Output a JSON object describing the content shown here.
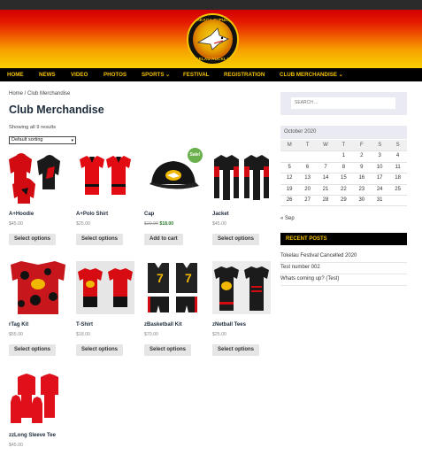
{
  "header": {
    "logo_top": "HAFAKAGA TUPULAGA",
    "logo_bottom": "TOKELAU AUCKLAND"
  },
  "nav": {
    "items": [
      {
        "label": "HOME"
      },
      {
        "label": "NEWS"
      },
      {
        "label": "VIDEO"
      },
      {
        "label": "PHOTOS"
      },
      {
        "label": "SPORTS ⌄"
      },
      {
        "label": "FESTIVAL"
      },
      {
        "label": "REGISTRATION"
      },
      {
        "label": "CLUB MERCHANDISE ⌄"
      }
    ]
  },
  "breadcrumb": "Home / Club Merchandise",
  "page_title": "Club Merchandise",
  "results_text": "Showing all 9 results",
  "sort": {
    "selected": "Default sorting"
  },
  "products": [
    {
      "name": "A+Hoodie",
      "price": "$45.00",
      "button": "Select options"
    },
    {
      "name": "A+Polo Shirt",
      "price": "$25.00",
      "button": "Select options"
    },
    {
      "name": "Cap",
      "old_price": "$20.00",
      "price": "$18.00",
      "button": "Add to cart",
      "badge": "Sale!"
    },
    {
      "name": "Jacket",
      "price": "$45.00",
      "button": "Select options"
    },
    {
      "name": "rTag Kit",
      "price": "$55.00",
      "button": "Select options"
    },
    {
      "name": "T-Shirt",
      "price": "$18.00",
      "button": "Select options"
    },
    {
      "name": "zBasketball Kit",
      "price": "$70.00",
      "button": "Select options"
    },
    {
      "name": "zNetball Tees",
      "price": "$25.00",
      "button": "Select options"
    },
    {
      "name": "zzLong Sleeve Tee",
      "price": "$45.00",
      "button": "Select options"
    }
  ],
  "search": {
    "placeholder": "SEARCH ..."
  },
  "calendar": {
    "caption": "October 2020",
    "days": [
      "M",
      "T",
      "W",
      "T",
      "F",
      "S",
      "S"
    ],
    "weeks": [
      [
        "",
        "",
        "",
        "1",
        "2",
        "3",
        "4"
      ],
      [
        "5",
        "6",
        "7",
        "8",
        "9",
        "10",
        "11"
      ],
      [
        "12",
        "13",
        "14",
        "15",
        "16",
        "17",
        "18"
      ],
      [
        "19",
        "20",
        "21",
        "22",
        "23",
        "24",
        "25"
      ],
      [
        "26",
        "27",
        "28",
        "29",
        "30",
        "31",
        ""
      ]
    ],
    "prev": "« Sep"
  },
  "recent_posts": {
    "title": "RECENT POSTS",
    "items": [
      "Tokelau Festival Cancelled 2020",
      "Test number 002",
      "Whats coming up? (Test)"
    ]
  },
  "colors": {
    "accent": "#f6c100",
    "nav_bg": "#000000",
    "sale_badge": "#6ab04c"
  }
}
